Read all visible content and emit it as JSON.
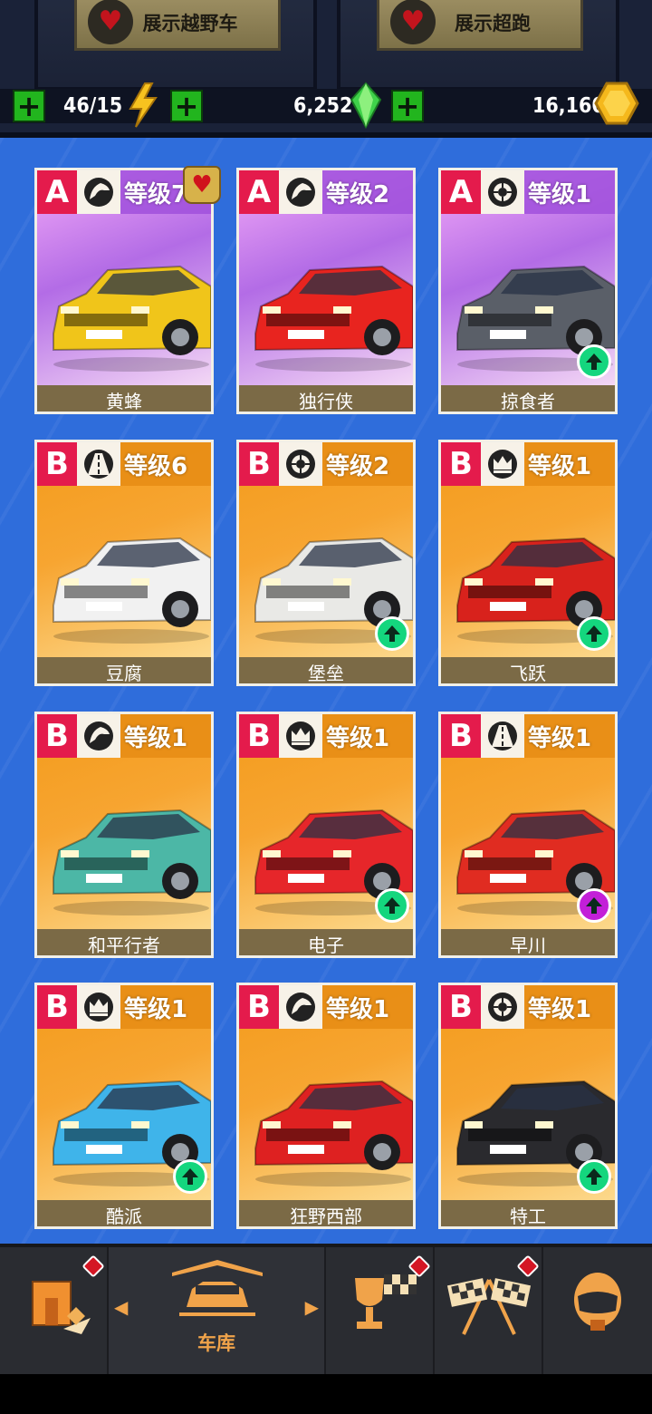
{
  "header": {
    "show_offroad_label": "展示越野车",
    "show_supercar_label": "展示超跑",
    "energy": "46/15",
    "gems": "6,252",
    "coins": "16,160"
  },
  "cars": [
    {
      "grade": "A",
      "class_icon": "horse-icon",
      "level": "等级7",
      "name": "黄蜂",
      "theme": "purple",
      "color": "#f0c51a",
      "favorite": true,
      "upgrade": null
    },
    {
      "grade": "A",
      "class_icon": "horse-icon",
      "level": "等级2",
      "name": "独行侠",
      "theme": "purple",
      "color": "#e8241f",
      "favorite": false,
      "upgrade": null
    },
    {
      "grade": "A",
      "class_icon": "tire-icon",
      "level": "等级1",
      "name": "掠食者",
      "theme": "purple",
      "color": "#5a5f68",
      "favorite": false,
      "upgrade": "green"
    },
    {
      "grade": "B",
      "class_icon": "road-icon",
      "level": "等级6",
      "name": "豆腐",
      "theme": "orange",
      "color": "#f1f1f1",
      "favorite": false,
      "upgrade": null
    },
    {
      "grade": "B",
      "class_icon": "tire-icon",
      "level": "等级2",
      "name": "堡垒",
      "theme": "orange",
      "color": "#e9e9e6",
      "favorite": false,
      "upgrade": "green"
    },
    {
      "grade": "B",
      "class_icon": "crown-icon",
      "level": "等级1",
      "name": "飞跃",
      "theme": "orange",
      "color": "#d8221c",
      "favorite": false,
      "upgrade": "green"
    },
    {
      "grade": "B",
      "class_icon": "horse-icon",
      "level": "等级1",
      "name": "和平行者",
      "theme": "orange",
      "color": "#4cb7a6",
      "favorite": false,
      "upgrade": null
    },
    {
      "grade": "B",
      "class_icon": "crown-icon",
      "level": "等级1",
      "name": "电子",
      "theme": "orange",
      "color": "#e6262a",
      "favorite": false,
      "upgrade": "green"
    },
    {
      "grade": "B",
      "class_icon": "road-icon",
      "level": "等级1",
      "name": "早川",
      "theme": "orange",
      "color": "#e02c21",
      "favorite": false,
      "upgrade": "purple"
    },
    {
      "grade": "B",
      "class_icon": "crown-icon",
      "level": "等级1",
      "name": "酷派",
      "theme": "orange",
      "color": "#3fb4ea",
      "favorite": false,
      "upgrade": "green"
    },
    {
      "grade": "B",
      "class_icon": "horse-icon",
      "level": "等级1",
      "name": "狂野西部",
      "theme": "orange",
      "color": "#de2121",
      "favorite": false,
      "upgrade": null
    },
    {
      "grade": "B",
      "class_icon": "tire-icon",
      "level": "等级1",
      "name": "特工",
      "theme": "orange",
      "color": "#2a2a2e",
      "favorite": false,
      "upgrade": "green"
    }
  ],
  "nav": {
    "garage_label": "车库"
  }
}
